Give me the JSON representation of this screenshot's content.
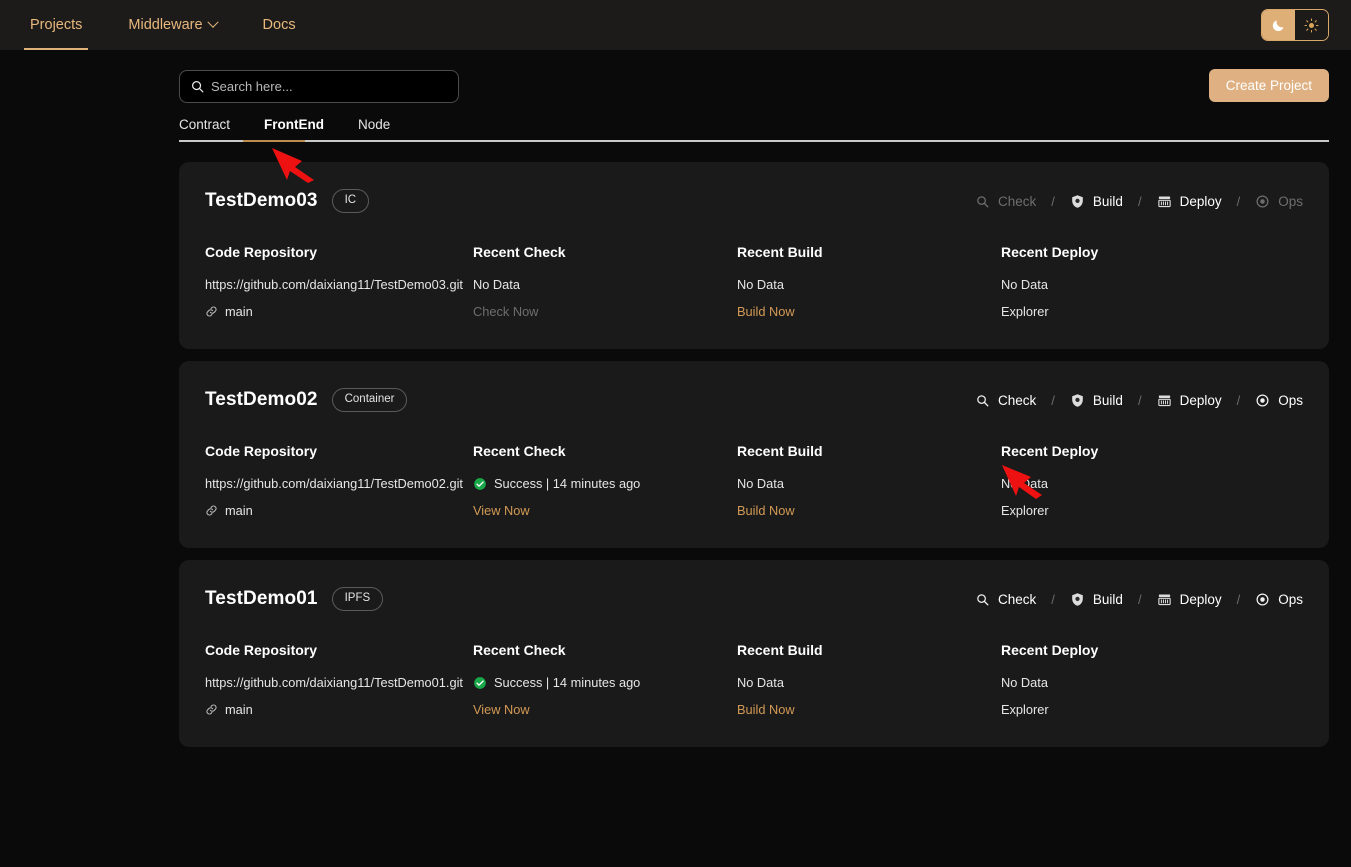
{
  "nav": {
    "items": [
      {
        "label": "Projects",
        "active": true,
        "caret": false
      },
      {
        "label": "Middleware",
        "active": false,
        "caret": true
      },
      {
        "label": "Docs",
        "active": false,
        "caret": false
      }
    ],
    "theme": {
      "dark_icon": "moon-icon",
      "light_icon": "sun-icon",
      "active": "dark",
      "active_bg": "#dfaf78"
    }
  },
  "toolbar": {
    "search_placeholder": "Search here...",
    "search_value": "",
    "search_icon": "search-icon",
    "create_label": "Create Project",
    "create_bg": "#dfb182"
  },
  "tabs": {
    "items": [
      "Contract",
      "FrontEnd",
      "Node"
    ],
    "active": "FrontEnd",
    "underline_color": "#c08c4e"
  },
  "columns": {
    "repo": "Code Repository",
    "check": "Recent Check",
    "build": "Recent Build",
    "deploy": "Recent Deploy"
  },
  "action_labels": {
    "check": "Check",
    "build": "Build",
    "deploy": "Deploy",
    "ops": "Ops",
    "separator": "/"
  },
  "projects": [
    {
      "name": "TestDemo03",
      "badge": "IC",
      "actions": {
        "check_enabled": false,
        "build_enabled": true,
        "deploy_enabled": true,
        "ops_enabled": false
      },
      "repo": {
        "url": "https://github.com/daixiang11/TestDemo03.git",
        "branch": "main",
        "branch_icon": "link-icon"
      },
      "check": {
        "status_text": "No Data",
        "status_icon": "",
        "action_label": "Check Now",
        "action_style": "muted"
      },
      "build": {
        "status_text": "No Data",
        "action_label": "Build Now",
        "action_style": "accent"
      },
      "deploy": {
        "status_text": "No Data",
        "action_label": "Explorer",
        "action_style": "plain"
      }
    },
    {
      "name": "TestDemo02",
      "badge": "Container",
      "actions": {
        "check_enabled": true,
        "build_enabled": true,
        "deploy_enabled": true,
        "ops_enabled": true
      },
      "repo": {
        "url": "https://github.com/daixiang11/TestDemo02.git",
        "branch": "main",
        "branch_icon": "link-icon"
      },
      "check": {
        "status_text": "Success | 14 minutes ago",
        "status_icon": "success-check-icon",
        "action_label": "View Now",
        "action_style": "accent"
      },
      "build": {
        "status_text": "No Data",
        "action_label": "Build Now",
        "action_style": "accent"
      },
      "deploy": {
        "status_text": "No Data",
        "action_label": "Explorer",
        "action_style": "plain"
      }
    },
    {
      "name": "TestDemo01",
      "badge": "IPFS",
      "actions": {
        "check_enabled": true,
        "build_enabled": true,
        "deploy_enabled": true,
        "ops_enabled": true
      },
      "repo": {
        "url": "https://github.com/daixiang11/TestDemo01.git",
        "branch": "main",
        "branch_icon": "link-icon"
      },
      "check": {
        "status_text": "Success | 14 minutes ago",
        "status_icon": "success-check-icon",
        "action_label": "View Now",
        "action_style": "accent"
      },
      "build": {
        "status_text": "No Data",
        "action_label": "Build Now",
        "action_style": "accent"
      },
      "deploy": {
        "status_text": "No Data",
        "action_label": "Explorer",
        "action_style": "plain"
      }
    }
  ],
  "annotations": {
    "color": "#ee1111",
    "arrows": [
      {
        "name": "arrow-pointing-frontend-tab"
      },
      {
        "name": "arrow-pointing-check-action"
      }
    ]
  }
}
